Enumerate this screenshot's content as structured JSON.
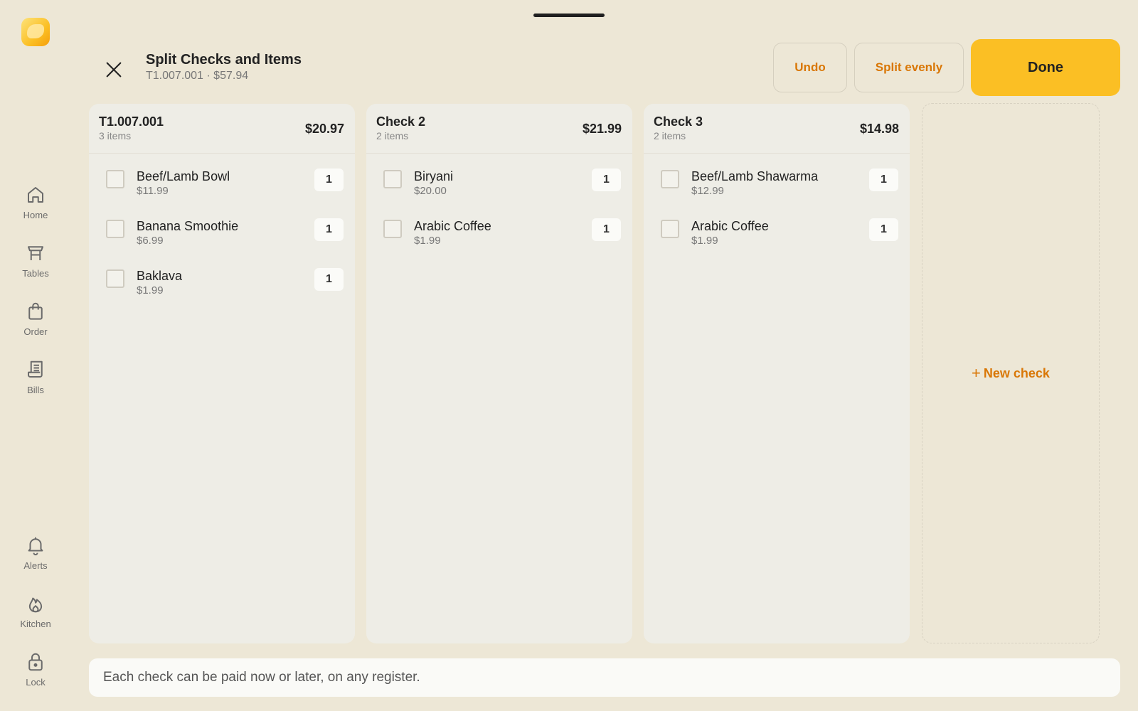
{
  "sidebar": {
    "logo_icon": "brand-logo-icon",
    "nav_top": [
      {
        "label": "Home",
        "icon": "home-icon"
      },
      {
        "label": "Tables",
        "icon": "table-icon"
      },
      {
        "label": "Order",
        "icon": "shopping-bag-icon"
      },
      {
        "label": "Bills",
        "icon": "receipt-icon"
      }
    ],
    "nav_bottom": [
      {
        "label": "Alerts",
        "icon": "bell-icon"
      },
      {
        "label": "Kitchen",
        "icon": "flame-icon"
      },
      {
        "label": "Lock",
        "icon": "lock-icon"
      }
    ]
  },
  "header": {
    "title": "Split Checks and Items",
    "subtitle": "T1.007.001 · $57.94",
    "undo_label": "Undo",
    "split_label": "Split evenly",
    "done_label": "Done"
  },
  "checks": [
    {
      "name": "T1.007.001",
      "count": "3 items",
      "total": "$20.97",
      "items": [
        {
          "name": "Beef/Lamb Bowl",
          "price": "$11.99",
          "qty": "1"
        },
        {
          "name": "Banana Smoothie",
          "price": "$6.99",
          "qty": "1"
        },
        {
          "name": "Baklava",
          "price": "$1.99",
          "qty": "1"
        }
      ]
    },
    {
      "name": "Check 2",
      "count": "2 items",
      "total": "$21.99",
      "items": [
        {
          "name": "Biryani",
          "price": "$20.00",
          "qty": "1"
        },
        {
          "name": "Arabic Coffee",
          "price": "$1.99",
          "qty": "1"
        }
      ]
    },
    {
      "name": "Check 3",
      "count": "2 items",
      "total": "$14.98",
      "items": [
        {
          "name": "Beef/Lamb Shawarma",
          "price": "$12.99",
          "qty": "1"
        },
        {
          "name": "Arabic Coffee",
          "price": "$1.99",
          "qty": "1"
        }
      ]
    }
  ],
  "new_check_label": "New check",
  "footer_note": "Each check can be paid now or later, on any register.",
  "colors": {
    "accent": "#d97706",
    "done_bg": "#fbbf24",
    "background": "#ede7d6",
    "card": "#eeede6"
  }
}
